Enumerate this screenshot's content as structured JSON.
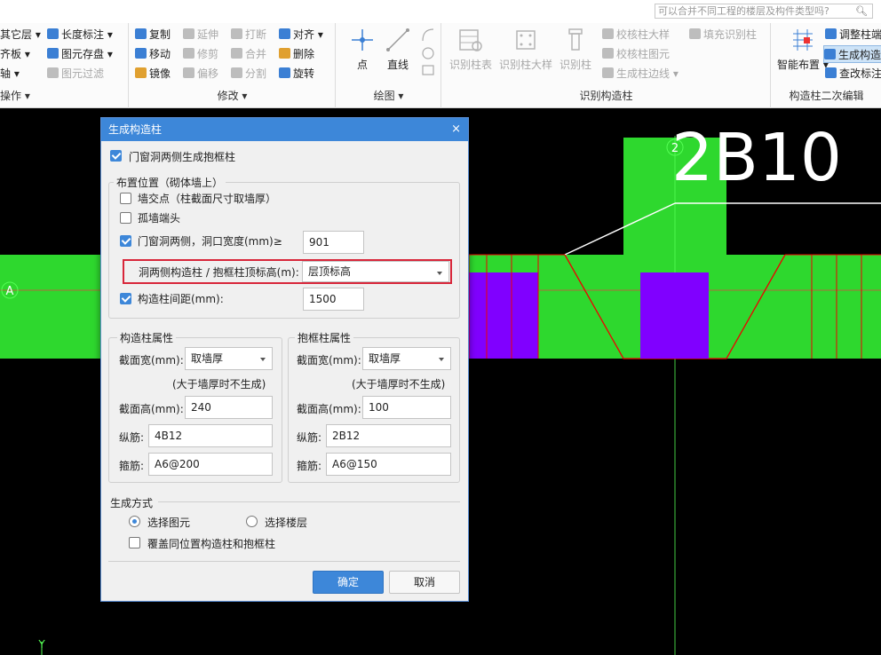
{
  "search": {
    "placeholder": "可以合并不同工程的楼层及构件类型吗?"
  },
  "ribbon": {
    "groups": {
      "g1": "操作",
      "g2": "修改",
      "g3": "绘图",
      "g4": "识别构造柱",
      "g5": "构造柱二次编辑"
    },
    "g1_items": [
      "其它层",
      "齐板",
      "轴"
    ],
    "dim_items": [
      "长度标注",
      "图元存盘",
      "图元过滤"
    ],
    "mod_col1": [
      "复制",
      "移动",
      "镜像"
    ],
    "mod_col2": [
      "延伸",
      "修剪",
      "偏移"
    ],
    "mod_col3": [
      "打断",
      "合并",
      "分割"
    ],
    "mod_col4": [
      "对齐",
      "删除",
      "旋转"
    ],
    "draw": [
      "点",
      "直线"
    ],
    "recog_big": [
      "识别柱表",
      "识别柱大样",
      "识别柱"
    ],
    "recog_small": [
      "校核柱大样",
      "校核柱图元",
      "生成柱边线",
      "填充识别柱"
    ],
    "smart": "智能布置",
    "edit_items": [
      "调整柱端",
      "生成构造",
      "查改标注"
    ]
  },
  "canvas": {
    "grid_a": "A",
    "grid_2": "2",
    "big_text": "2B10",
    "axis_y": "Y"
  },
  "dialog": {
    "title": "生成构造柱",
    "close": "×",
    "top_check": "门窗洞两侧生成抱框柱",
    "placement": {
      "title": "布置位置（砌体墙上）",
      "wall_cross": "墙交点（柱截面尺寸取墙厚）",
      "isolated": "孤墙端头",
      "opening_sides": "门窗洞两侧，洞口宽度(mm)≥",
      "opening_width": "901",
      "top_elev_label": "洞两侧构造柱 / 抱框柱顶标高(m):",
      "top_elev_value": "层顶标高",
      "spacing_label": "构造柱间距(mm):",
      "spacing_value": "1500"
    },
    "gz": {
      "title": "构造柱属性",
      "width_label": "截面宽(mm):",
      "width_value": "取墙厚",
      "note": "(大于墙厚时不生成)",
      "height_label": "截面高(mm):",
      "height_value": "240",
      "long_label": "纵筋:",
      "long_value": "4B12",
      "stirrup_label": "箍筋:",
      "stirrup_value": "A6@200"
    },
    "bk": {
      "title": "抱框柱属性",
      "width_label": "截面宽(mm):",
      "width_value": "取墙厚",
      "note": "(大于墙厚时不生成)",
      "height_label": "截面高(mm):",
      "height_value": "100",
      "long_label": "纵筋:",
      "long_value": "2B12",
      "stirrup_label": "箍筋:",
      "stirrup_value": "A6@150"
    },
    "method": {
      "title": "生成方式",
      "pick_elem": "选择图元",
      "pick_floor": "选择楼层",
      "overwrite": "覆盖同位置构造柱和抱框柱"
    },
    "ok": "确定",
    "cancel": "取消"
  },
  "colors": {
    "accent": "#3d87d9",
    "wall": "#2ed82e",
    "column": "#8000ff",
    "highlight": "#d8263a"
  }
}
